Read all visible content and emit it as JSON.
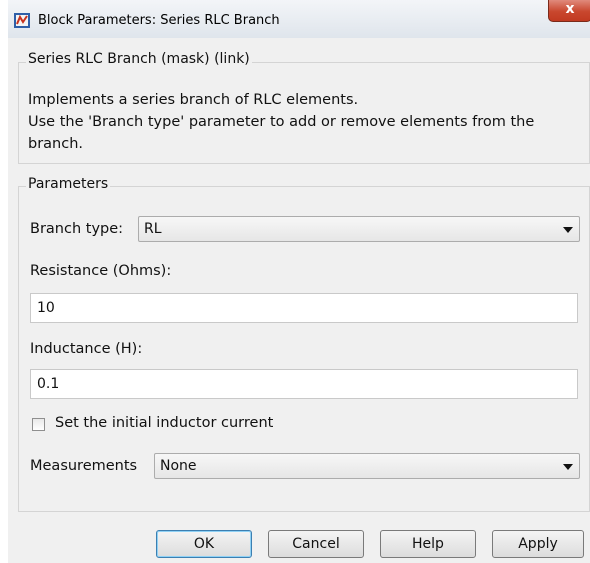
{
  "window": {
    "title": "Block Parameters: Series RLC Branch",
    "close_label": "x"
  },
  "mask": {
    "legend": "Series RLC Branch (mask) (link)",
    "description_line1": "Implements a series branch of RLC elements.",
    "description_line2": "Use the 'Branch type' parameter to add or remove elements from the",
    "description_line3": "branch."
  },
  "parameters": {
    "legend": "Parameters",
    "branch_type_label": "Branch type:",
    "branch_type_value": "RL",
    "resistance_label": "Resistance (Ohms):",
    "resistance_value": "10",
    "inductance_label": "Inductance (H):",
    "inductance_value": "0.1",
    "initial_current_label": "Set the initial inductor current",
    "initial_current_checked": false,
    "measurements_label": "Measurements",
    "measurements_value": "None"
  },
  "buttons": {
    "ok": "OK",
    "cancel": "Cancel",
    "help": "Help",
    "apply": "Apply"
  },
  "colors": {
    "dialog_bg": "#f0f0f0",
    "close_button": "#c9472e",
    "default_button_border": "#3c7fb1"
  }
}
